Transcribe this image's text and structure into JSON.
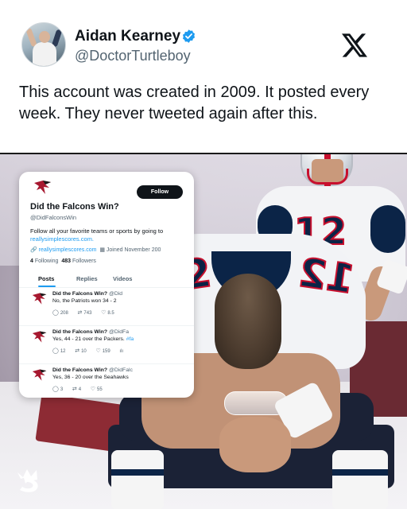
{
  "tweet": {
    "display_name": "Aidan Kearney",
    "handle": "@DoctorTurtleboy",
    "verified": true,
    "text": "This account was created in 2009. It posted every week. They never tweeted again after this."
  },
  "photo": {
    "jersey_number": "12"
  },
  "embedded_profile": {
    "follow_label": "Follow",
    "name": "Did the Falcons Win?",
    "handle": "@DidFalconsWin",
    "bio_text": "Follow all your favorite teams or sports by going to",
    "bio_link": "reallysimplescores.com.",
    "website": "reallysimplescores.com",
    "joined": "Joined November 200",
    "following_count": "4",
    "following_label": "Following",
    "followers_count": "483",
    "followers_label": "Followers",
    "tabs": [
      "Posts",
      "Replies",
      "Videos"
    ],
    "posts": [
      {
        "name": "Did the Falcons Win?",
        "handle": "@Did",
        "body": "No, the Patriots won 34 - 2",
        "hashtag": "",
        "replies": "208",
        "reposts": "743",
        "likes": "8.5",
        "views": ""
      },
      {
        "name": "Did the Falcons Win?",
        "handle": "@DidFa",
        "body": "Yes, 44 - 21 over the Packers.",
        "hashtag": "#fa",
        "replies": "12",
        "reposts": "10",
        "likes": "159",
        "views": "ılı"
      },
      {
        "name": "Did the Falcons Win?",
        "handle": "@DidFalc",
        "body": "Yes, 36 - 20 over the Seahawks",
        "hashtag": "",
        "replies": "3",
        "reposts": "4",
        "likes": "55",
        "views": ""
      }
    ]
  },
  "colors": {
    "x_accent": "#1d9bf0",
    "text_primary": "#0f1419",
    "text_secondary": "#536471",
    "patriots_navy": "#0b2447",
    "patriots_red": "#c8102e",
    "falcons_red": "#a71930"
  },
  "icons": {
    "verified": "verified-badge-icon",
    "x_logo": "x-logo-icon",
    "falcons_logo": "falcons-logo-icon",
    "brand_logo": "draftkings-crown-icon"
  }
}
